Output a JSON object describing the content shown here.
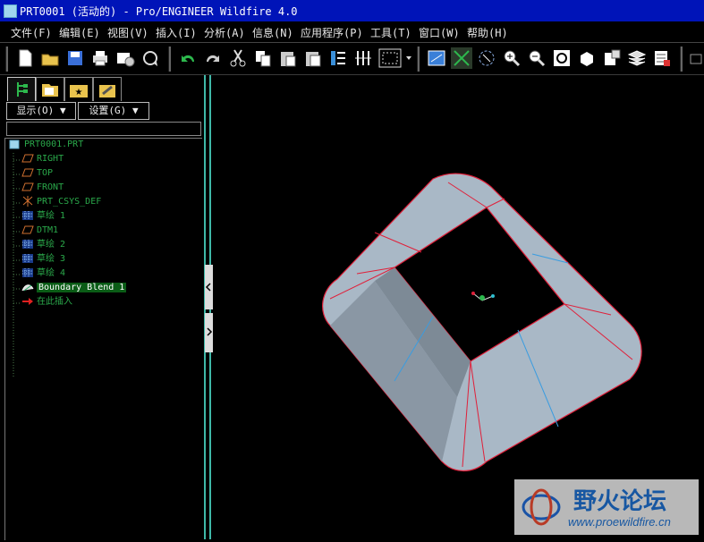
{
  "window": {
    "title": "PRT0001 (活动的) - Pro/ENGINEER Wildfire 4.0"
  },
  "menu": {
    "items": [
      {
        "label": "文件(F)"
      },
      {
        "label": "编辑(E)"
      },
      {
        "label": "视图(V)"
      },
      {
        "label": "插入(I)"
      },
      {
        "label": "分析(A)"
      },
      {
        "label": "信息(N)"
      },
      {
        "label": "应用程序(P)"
      },
      {
        "label": "工具(T)"
      },
      {
        "label": "窗口(W)"
      },
      {
        "label": "帮助(H)"
      }
    ]
  },
  "toolbar": {
    "icons": [
      "new-file-icon",
      "open-folder-icon",
      "save-icon",
      "print-icon",
      "send-mail-icon",
      "regenerate-icon",
      "undo-icon",
      "redo-icon",
      "cut-icon",
      "copy-icon",
      "paste-icon",
      "paste-special-icon",
      "relation-icon",
      "feature-list-icon",
      "selection-box-icon",
      "repaint-icon",
      "spin-center-icon",
      "orient-icon",
      "zoom-in-icon",
      "zoom-out-icon",
      "refit-icon",
      "reorient-icon",
      "saved-views-icon",
      "layers-icon",
      "view-manager-icon",
      "datum-plane-icon"
    ]
  },
  "left_panel": {
    "show_label": "显示(O)",
    "settings_label": "设置(G)",
    "filter_value": "",
    "tree": [
      {
        "label": "PRT0001.PRT",
        "icon": "part-icon"
      },
      {
        "label": "RIGHT",
        "icon": "datum-plane-icon"
      },
      {
        "label": "TOP",
        "icon": "datum-plane-icon"
      },
      {
        "label": "FRONT",
        "icon": "datum-plane-icon"
      },
      {
        "label": "PRT_CSYS_DEF",
        "icon": "coordinate-system-icon"
      },
      {
        "label": "草绘 1",
        "icon": "sketch-icon"
      },
      {
        "label": "DTM1",
        "icon": "datum-plane-icon"
      },
      {
        "label": "草绘 2",
        "icon": "sketch-icon"
      },
      {
        "label": "草绘 3",
        "icon": "sketch-icon"
      },
      {
        "label": "草绘 4",
        "icon": "sketch-icon"
      },
      {
        "label": "Boundary Blend 1",
        "icon": "boundary-blend-icon",
        "selected": true
      },
      {
        "label": "在此插入",
        "icon": "insert-here-arrow-icon"
      }
    ]
  },
  "watermark": {
    "title": "野火论坛",
    "url": "www.proewildfire.cn"
  },
  "colors": {
    "title_bar": "#0014b8",
    "tree_text": "#2aa84a",
    "selected_bg": "#0a5c16",
    "edge_red": "#e0203a",
    "surface": "#a9b8c6",
    "divider_cyan": "#3fb8a8"
  }
}
